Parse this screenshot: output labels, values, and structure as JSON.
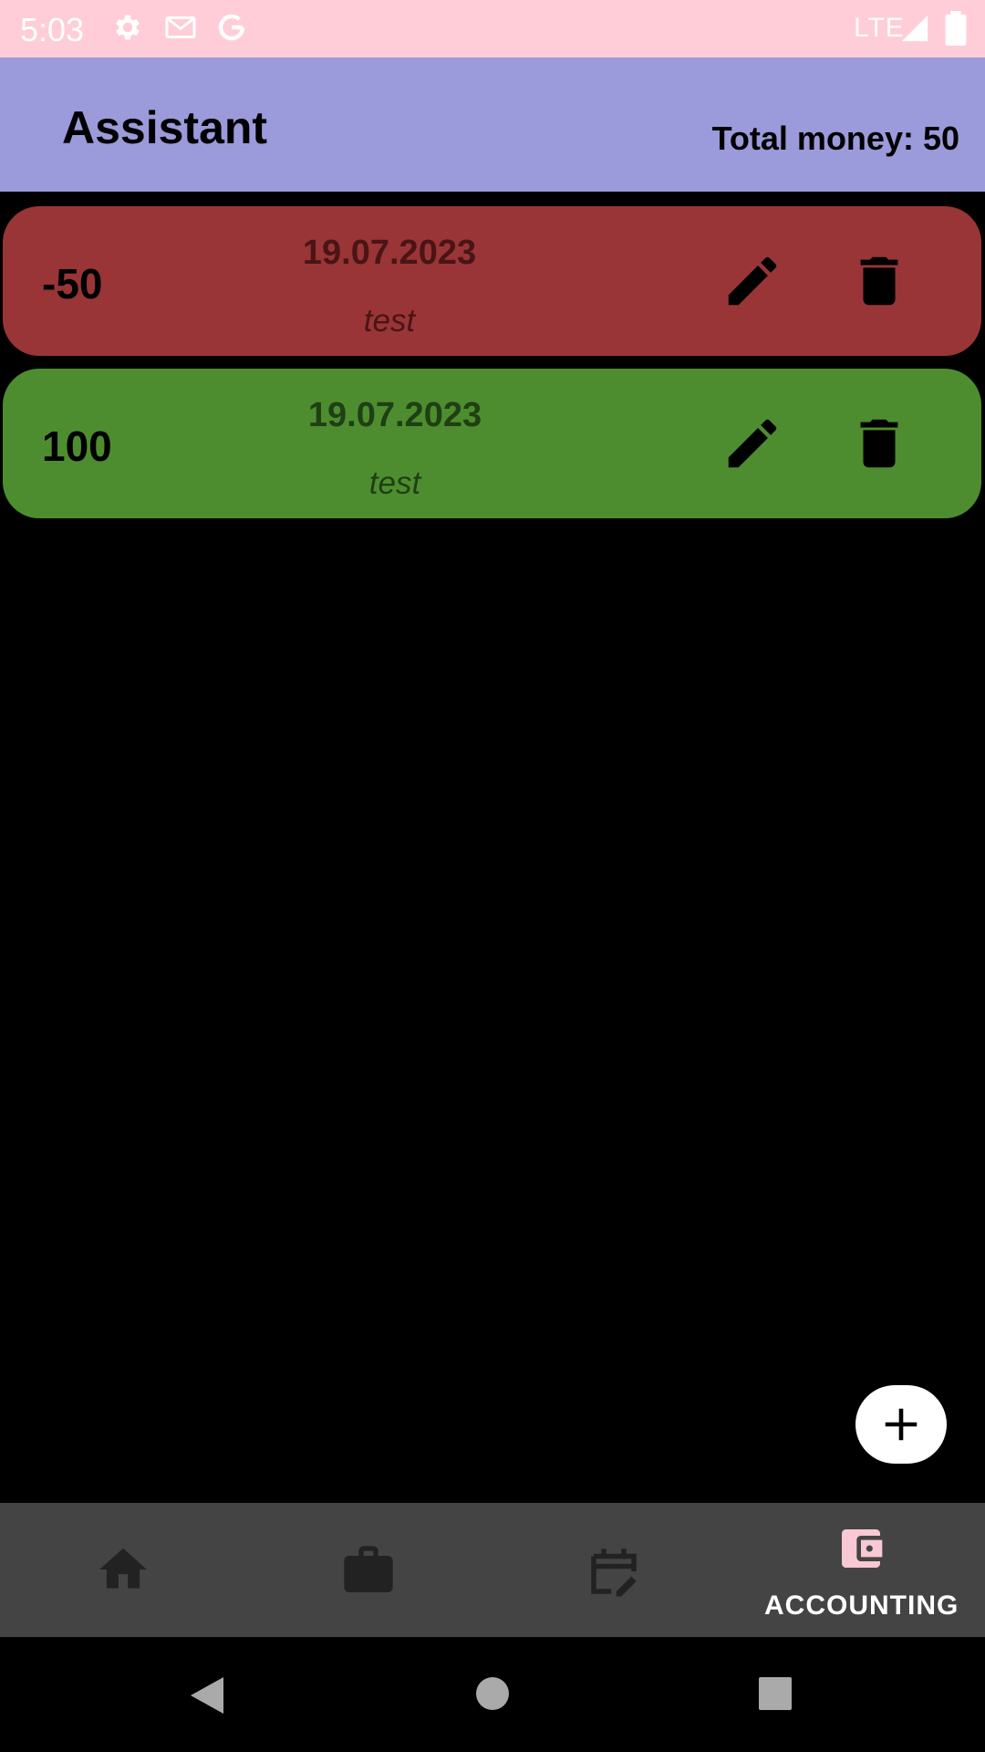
{
  "status_bar": {
    "time": "5:03",
    "network": "LTE",
    "icons": [
      "settings-icon",
      "gmail-icon",
      "google-icon",
      "signal-icon",
      "battery-icon"
    ]
  },
  "app_bar": {
    "title": "Assistant",
    "total_money": "Total money: 50"
  },
  "entries": [
    {
      "amount": "-50",
      "date": "19.07.2023",
      "note": "test",
      "color": "#993537"
    },
    {
      "amount": "100",
      "date": "19.07.2023",
      "note": "test",
      "color": "#4e8d2f"
    }
  ],
  "fab": {
    "icon": "plus-icon"
  },
  "bottom_nav": {
    "items": [
      {
        "icon": "home-icon"
      },
      {
        "icon": "briefcase-icon"
      },
      {
        "icon": "calendar-edit-icon"
      },
      {
        "icon": "wallet-icon",
        "label": "ACCOUNTING",
        "active": true
      }
    ]
  },
  "system_nav": {
    "icons": [
      "back-icon",
      "home-circle-icon",
      "recents-icon"
    ]
  },
  "colors": {
    "status_bar": "#ffcdd8",
    "app_bar": "#9b9ada",
    "expense": "#993537",
    "income": "#4e8d2f",
    "nav_bar": "#444444",
    "active_icon": "#f8c8d4"
  }
}
